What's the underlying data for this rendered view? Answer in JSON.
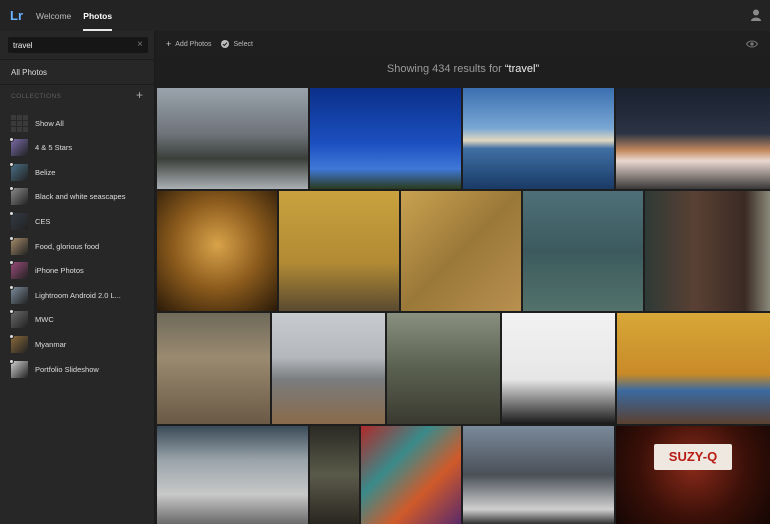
{
  "topbar": {
    "logo": "Lr",
    "tabs": [
      "Welcome",
      "Photos"
    ],
    "active_tab": "Photos"
  },
  "sidebar": {
    "search": {
      "value": "travel",
      "placeholder": "Search"
    },
    "all_photos": "All Photos",
    "collections_header": "COLLECTIONS",
    "collections": [
      {
        "label": "Show All",
        "icon": "grid-icon",
        "color": "#555555"
      },
      {
        "label": "4 & 5 Stars",
        "icon": "collection-thumb",
        "color": "#7a6aa8"
      },
      {
        "label": "Belize",
        "icon": "collection-thumb",
        "color": "#4a6f86"
      },
      {
        "label": "Black and white seascapes",
        "icon": "collection-thumb",
        "color": "#8a8a8a"
      },
      {
        "label": "CES",
        "icon": "collection-thumb",
        "color": "#333a44"
      },
      {
        "label": "Food, glorious food",
        "icon": "collection-thumb",
        "color": "#a58a6a"
      },
      {
        "label": "iPhone Photos",
        "icon": "collection-thumb",
        "color": "#9a4a7a"
      },
      {
        "label": "Lightroom Android 2.0 L...",
        "icon": "collection-thumb",
        "color": "#7a8a9a"
      },
      {
        "label": "MWC",
        "icon": "collection-thumb",
        "color": "#6a6a6a"
      },
      {
        "label": "Myanmar",
        "icon": "collection-thumb",
        "color": "#8a6a3a"
      },
      {
        "label": "Portfolio Slideshow",
        "icon": "collection-thumb",
        "color": "#cfcfcf"
      }
    ]
  },
  "toolbar": {
    "add_photos": "Add Photos",
    "select": "Select"
  },
  "results": {
    "prefix": "Showing 434 results for ",
    "query": "“travel”"
  },
  "photos": [
    {
      "name": "photo-berlin-cathedral",
      "bg": "linear-gradient(180deg,#9aa3ac 0%,#6e747a 45%,#3b3f3a 70%,#aab0b3 100%)"
    },
    {
      "name": "photo-blue-sky-spire",
      "bg": "linear-gradient(180deg,#0a2f8a 0%,#1c50c0 55%,#3f78d8 80%,#2a3a1c 100%)"
    },
    {
      "name": "photo-jefferson-memorial",
      "bg": "linear-gradient(180deg,#3b6fb0 0%,#79a7d4 40%,#e2d8c0 52%,#3f6fa4 60%,#1a3a66 100%)"
    },
    {
      "name": "photo-night-light-trails",
      "bg": "linear-gradient(180deg,#1a2230 0%,#2b3344 45%,#c58a60 62%,#e9d8d0 72%,#3a3838 100%)"
    },
    {
      "name": "photo-golden-buddha",
      "bg": "radial-gradient(circle at 50% 45%,#d9a34a 0%,#8a5a1c 50%,#2a1a08 100%)"
    },
    {
      "name": "photo-rickshaw",
      "bg": "linear-gradient(180deg,#c9a23e 0%,#b18a34 60%,#5a4a30 100%)"
    },
    {
      "name": "photo-lanterns-wall",
      "bg": "linear-gradient(135deg,#c9a250 0%,#9a7838 50%,#b89050 100%)"
    },
    {
      "name": "photo-boats",
      "bg": "linear-gradient(180deg,#4f6f78 0%,#3c5a5e 50%,#52726a 100%)"
    },
    {
      "name": "photo-bicycle-door",
      "bg": "linear-gradient(90deg,#2f3a36 0%,#5a4034 40%,#3a2a24 80%,#8a8a7a 100%)"
    },
    {
      "name": "photo-red-lanterns",
      "bg": "linear-gradient(180deg,#6f6a5a 0%,#9a8a70 40%,#6a5a46 100%)"
    },
    {
      "name": "photo-beach-umbrellas",
      "bg": "linear-gradient(180deg,#c8ccd0 0%,#b4b8bc 40%,#7a7c7e 60%,#8a6a4a 100%)"
    },
    {
      "name": "photo-temple-bridge",
      "bg": "linear-gradient(180deg,#8a9080 0%,#5a6050 50%,#3a3a30 100%)"
    },
    {
      "name": "photo-statues",
      "bg": "linear-gradient(180deg,#f2f2f2 0%,#e6e6e6 60%,#1a1a1a 100%)"
    },
    {
      "name": "photo-yellow-shopfront",
      "bg": "linear-gradient(180deg,#d8a838 0%,#c88a28 55%,#3a6aa0 70%,#5a4030 100%)"
    },
    {
      "name": "photo-street-musician",
      "bg": "linear-gradient(180deg,#3a4a58 0%,#9aa4aa 35%,#c8c8c8 70%,#6a6a6a 100%)"
    },
    {
      "name": "photo-alley-shops",
      "bg": "linear-gradient(180deg,#2a2a24 0%,#5a5a4a 50%,#2a2620 100%)"
    },
    {
      "name": "photo-stained-glass",
      "bg": "linear-gradient(135deg,#b02a2a 0%,#3a8a8a 35%,#d05a2a 65%,#5a2a6a 100%)"
    },
    {
      "name": "photo-crosswalk",
      "bg": "linear-gradient(180deg,#7a8a9a 0%,#4a5058 50%,#d0d0d0 85%,#303030 100%)"
    },
    {
      "name": "photo-suzy-q-sign",
      "bg": "radial-gradient(circle at 50% 40%,#8a2a1a 0%,#3a1008 55%,#140604 100%)"
    }
  ],
  "overlay_texts": {
    "suzy_q": "SUZY-Q"
  }
}
